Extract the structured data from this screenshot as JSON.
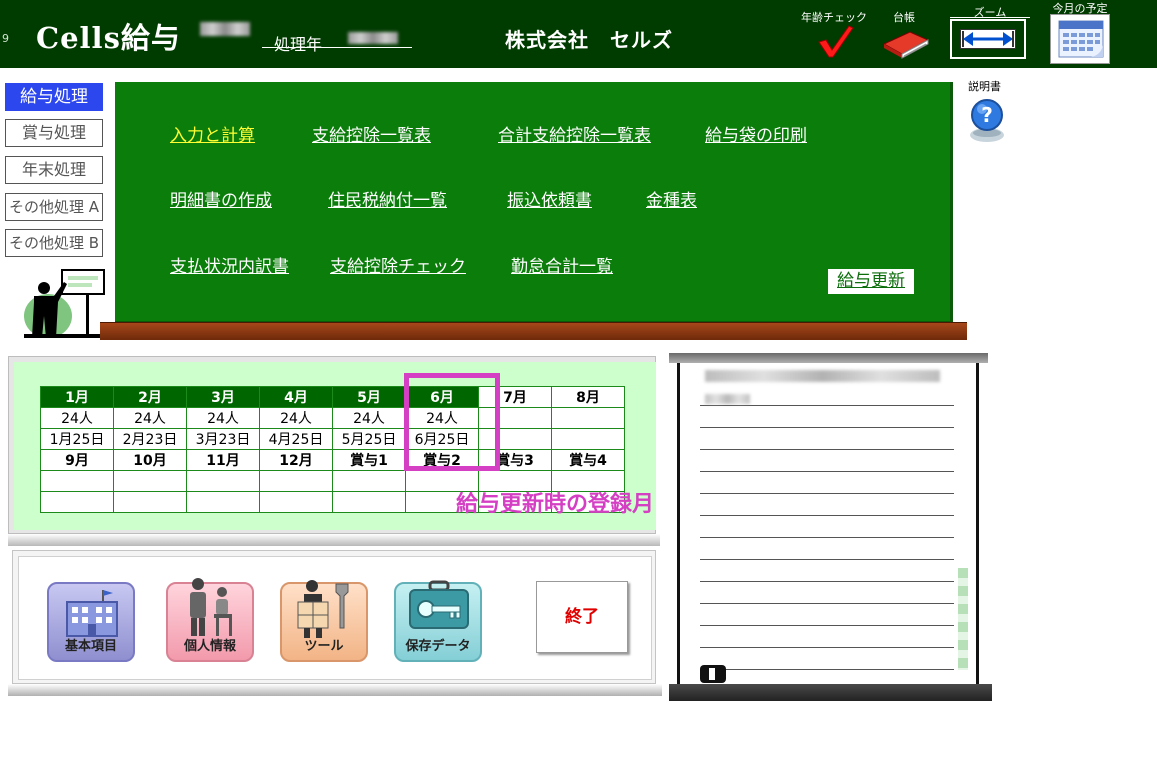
{
  "header": {
    "left_number": "9",
    "app_title": "Cells給与",
    "year_label": "処理年",
    "company_name": "株式会社　セルズ",
    "age_check_label": "年齢チェック",
    "ledger_label": "台帳",
    "zoom_label": "ズーム",
    "schedule_label": "今月の予定"
  },
  "tabs": [
    {
      "label": "給与処理",
      "active": true
    },
    {
      "label": "賞与処理",
      "active": false
    },
    {
      "label": "年末処理",
      "active": false
    },
    {
      "label": "その他処理 A",
      "active": false
    },
    {
      "label": "その他処理 B",
      "active": false
    }
  ],
  "menu": {
    "row1": [
      "入力と計算",
      "支給控除一覧表",
      "合計支給控除一覧表",
      "給与袋の印刷"
    ],
    "row2": [
      "明細書の作成",
      "住民税納付一覧",
      "振込依頼書",
      "金種表"
    ],
    "row3": [
      "支払状況内訳書",
      "支給控除チェック",
      "勤怠合計一覧"
    ],
    "update_button": "給与更新"
  },
  "manual_label": "説明書",
  "calendar": {
    "months_top": [
      "1月",
      "2月",
      "3月",
      "4月",
      "5月",
      "6月",
      "7月",
      "8月"
    ],
    "headcount": [
      "24人",
      "24人",
      "24人",
      "24人",
      "24人",
      "24人",
      "",
      ""
    ],
    "pay_dates": [
      "1月25日",
      "2月23日",
      "3月23日",
      "4月25日",
      "5月25日",
      "6月25日",
      "",
      ""
    ],
    "months_bottom": [
      "9月",
      "10月",
      "11月",
      "12月",
      "賞与1",
      "賞与2",
      "賞与3",
      "賞与4"
    ]
  },
  "annotation": "給与更新時の登録月",
  "bottom_buttons": {
    "basic": "基本項目",
    "personal": "個人情報",
    "tool": "ツール",
    "save": "保存データ",
    "exit": "終了"
  },
  "colors": {
    "header_bg": "#003b00",
    "board_green": "#0b7d0b",
    "active_tab": "#2c47ee",
    "highlight": "#d43fc4",
    "exit_red": "#e00000"
  }
}
